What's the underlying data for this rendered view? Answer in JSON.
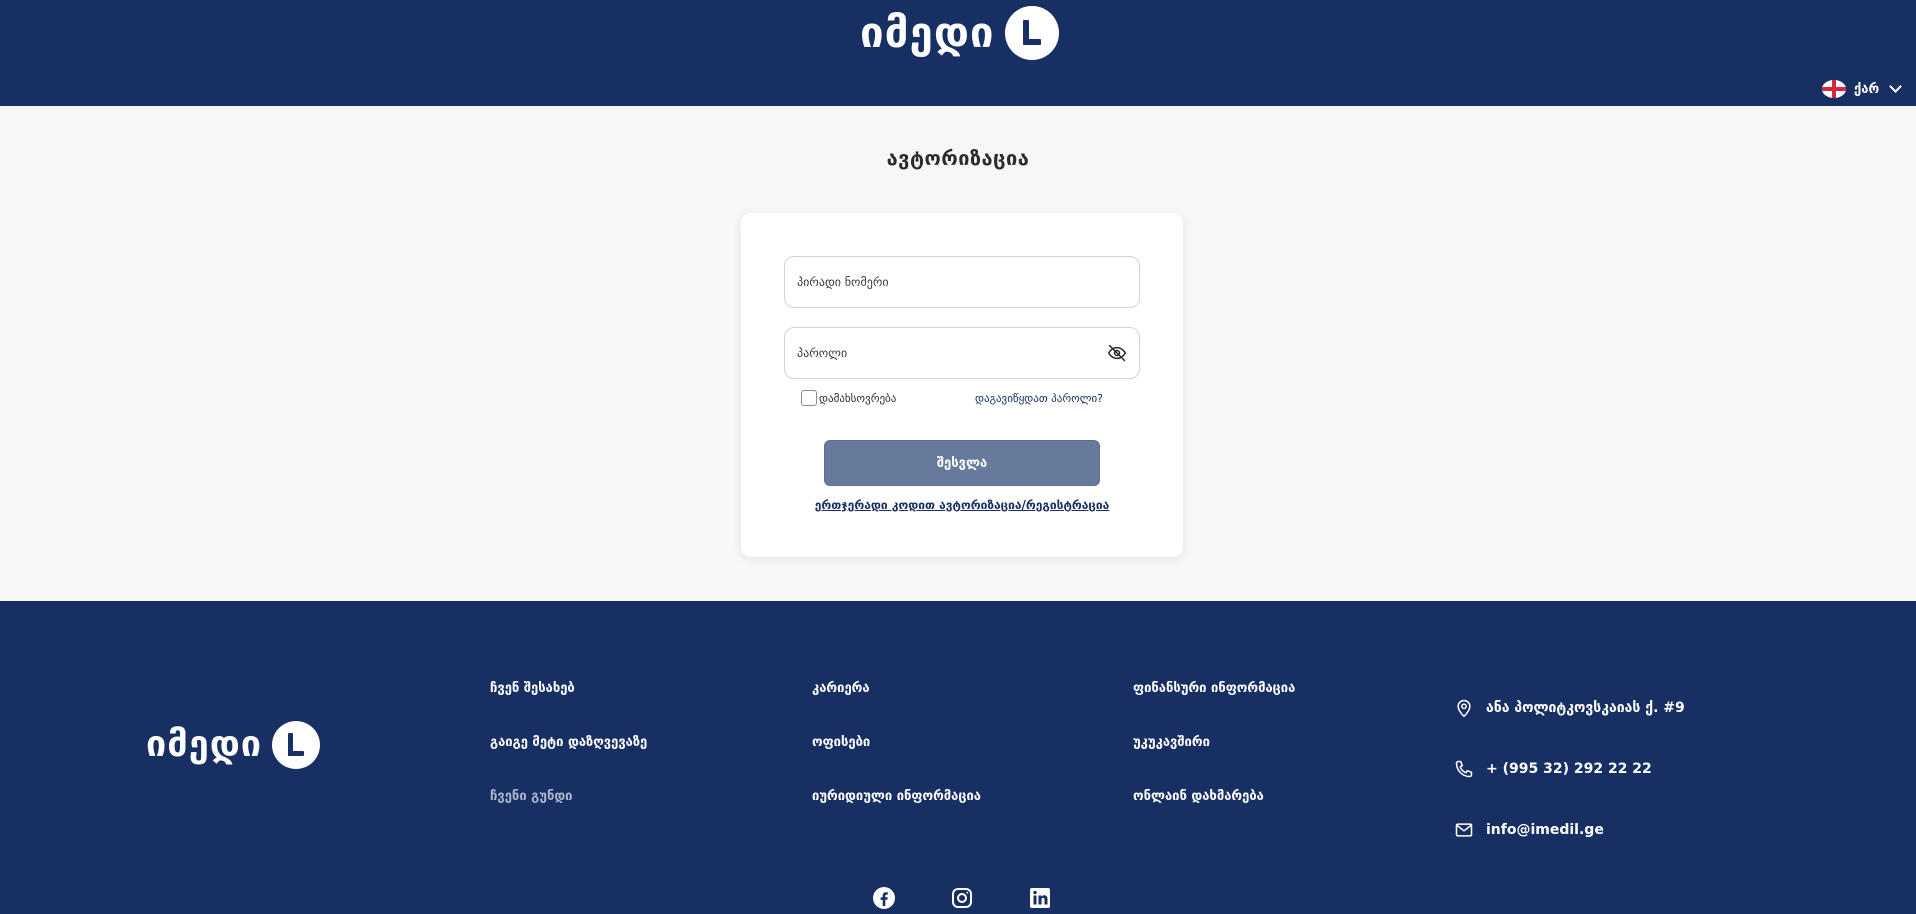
{
  "header": {
    "logo_text": "იმედი",
    "logo_mark": "L",
    "language": {
      "label": "ქარ",
      "flag_icon": "georgia-flag-icon",
      "dropdown_icon": "chevron-down-icon"
    }
  },
  "page_title": "ავტორიზაცია",
  "login_form": {
    "id_placeholder": "პირადი ნომერი",
    "id_value": "",
    "password_placeholder": "პაროლი",
    "password_value": "",
    "password_toggle_icon": "eye-off-icon",
    "remember_label": "დამახსოვრება",
    "remember_checked": false,
    "forgot_label": "დაგავიწყდათ პაროლი?",
    "submit_label": "შესვლა",
    "otp_link": "ერთჯერადი კოდით ავტორიზაცია/რეგისტრაცია"
  },
  "footer": {
    "logo_text": "იმედი",
    "logo_mark": "L",
    "columns": [
      [
        "ჩვენ შესახებ",
        "გაიგე მეტი დაზღვევაზე",
        "ჩვენი გუნდი"
      ],
      [
        "კარიერა",
        "ოფისები",
        "იურიდიული ინფორმაცია"
      ],
      [
        "ფინანსური ინფორმაცია",
        "უკუკავშირი",
        "ონლაინ დახმარება"
      ]
    ],
    "contacts": {
      "address": "ანა პოლიტკოვსკაიას ქ. #9",
      "phone": "+ (995 32) 292 22 22",
      "email": "info@imedil.ge"
    },
    "social_icons": [
      "facebook-icon",
      "instagram-icon",
      "linkedin-icon"
    ],
    "colors": {
      "background": "#172f63",
      "muted_link": "#aab4cb"
    }
  },
  "colors": {
    "brand": "#172f63",
    "button": "#687a9c",
    "page_bg": "#f7f7f7"
  }
}
